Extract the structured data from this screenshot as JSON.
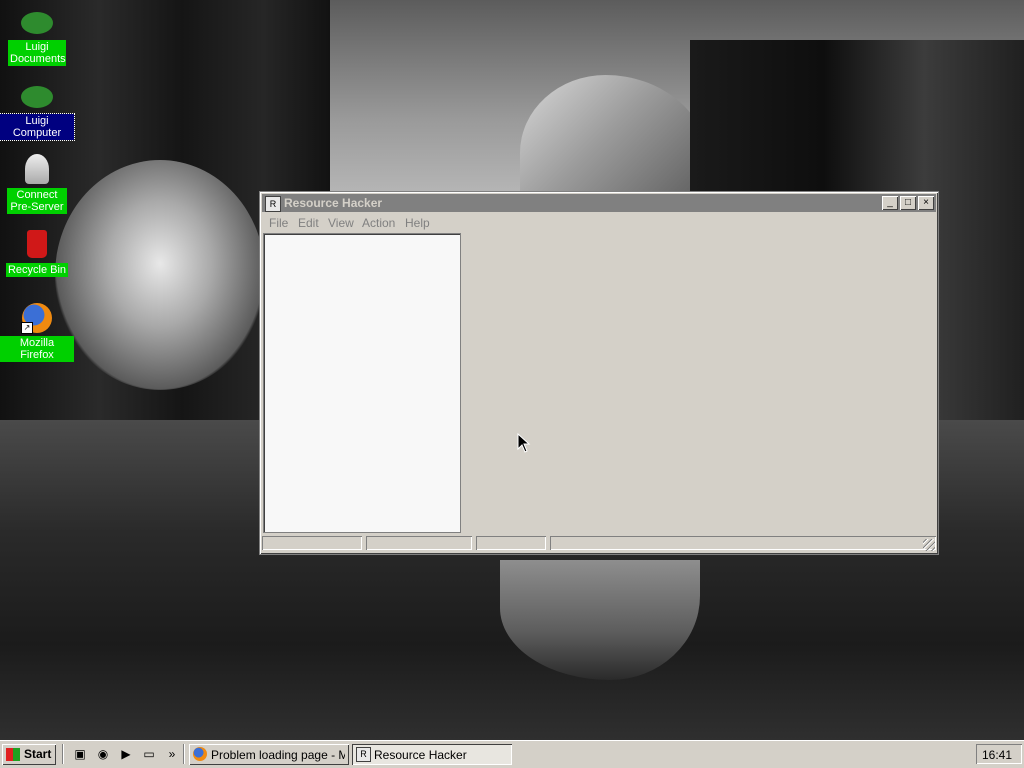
{
  "desktop": {
    "icons": [
      {
        "label": "Luigi Documents",
        "icon": "green-blob-icon"
      },
      {
        "label": "Luigi Computer",
        "icon": "green-blob-icon"
      },
      {
        "label": "Connect Pre-Server",
        "icon": "server-icon"
      },
      {
        "label": "Recycle Bin",
        "icon": "recycle-bin-icon"
      },
      {
        "label": "Mozilla Firefox",
        "icon": "firefox-icon"
      }
    ]
  },
  "window": {
    "title": "Resource Hacker",
    "controls": {
      "minimize": "_",
      "maximize": "□",
      "close": "×"
    },
    "menu": [
      {
        "label": "File"
      },
      {
        "label": "Edit"
      },
      {
        "label": "View"
      },
      {
        "label": "Action"
      },
      {
        "label": "Help"
      }
    ]
  },
  "taskbar": {
    "start_label": "Start",
    "quick_launch": [
      "show-desktop-icon",
      "browser-icon",
      "media-player-icon",
      "window-icon"
    ],
    "chevron": "»",
    "tasks": [
      {
        "label": "Problem loading page - Mo...",
        "icon": "firefox-icon",
        "active": false
      },
      {
        "label": "Resource Hacker",
        "icon": "resource-hacker-icon",
        "active": true
      }
    ],
    "clock": "16:41"
  },
  "colors": {
    "icon_label_bg": "#00d000",
    "selected_label_bg": "#000080",
    "inactive_titlebar": "#808080",
    "window_face": "#d4d0c8"
  }
}
